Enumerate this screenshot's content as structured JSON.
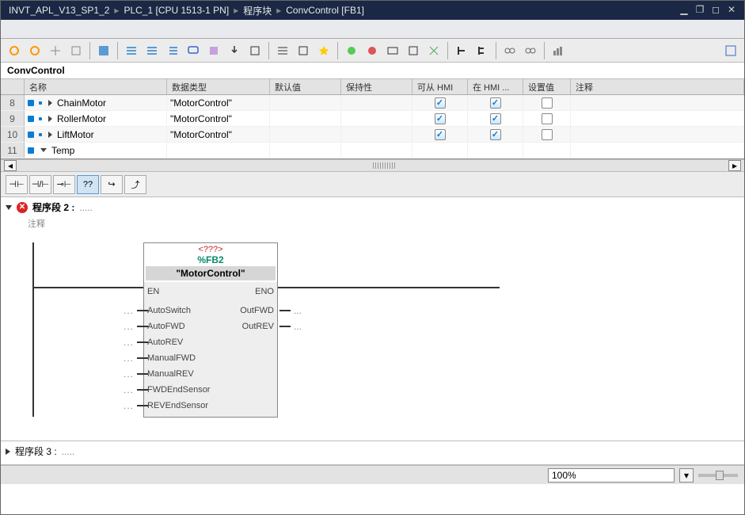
{
  "breadcrumb": [
    "INVT_APL_V13_SP1_2",
    "PLC_1 [CPU 1513-1 PN]",
    "程序块",
    "ConvControl [FB1]"
  ],
  "blockName": "ConvControl",
  "table": {
    "headers": {
      "name": "名称",
      "type": "数据类型",
      "def": "默认值",
      "ret": "保持性",
      "hmi1": "可从 HMI ...",
      "hmi2": "在 HMI ...",
      "set": "设置值",
      "comm": "注释"
    },
    "rows": [
      {
        "num": "8",
        "name": "ChainMotor",
        "type": "\"MotorControl\"",
        "hmi1": true,
        "hmi2": true,
        "expand": false,
        "leaf": true
      },
      {
        "num": "9",
        "name": "RollerMotor",
        "type": "\"MotorControl\"",
        "hmi1": true,
        "hmi2": true,
        "expand": false,
        "leaf": true
      },
      {
        "num": "10",
        "name": "LiftMotor",
        "type": "\"MotorControl\"",
        "hmi1": true,
        "hmi2": true,
        "expand": false,
        "leaf": true
      },
      {
        "num": "11",
        "name": "Temp",
        "type": "",
        "hmi1": null,
        "hmi2": null,
        "expand": true,
        "leaf": false
      }
    ]
  },
  "instBar": {
    "items": [
      "⊣⊢",
      "⊣/⊢",
      "⊸⊢",
      "??",
      "↪",
      "⤴"
    ],
    "selected": 3
  },
  "segment2": {
    "title": "程序段 2 :",
    "hint": ".....",
    "comment": "注释",
    "block": {
      "unknown": "<???>",
      "fb": "%FB2",
      "name": "\"MotorControl\"",
      "en": "EN",
      "eno": "ENO",
      "inputs": [
        "AutoSwitch",
        "AutoFWD",
        "AutoREV",
        "ManualFWD",
        "ManualREV",
        "FWDEndSensor",
        "REVEndSensor"
      ],
      "outputs": [
        "OutFWD",
        "OutREV"
      ]
    }
  },
  "segment3": {
    "title": "程序段 3 :",
    "hint": "....."
  },
  "status": {
    "zoom": "100%"
  }
}
